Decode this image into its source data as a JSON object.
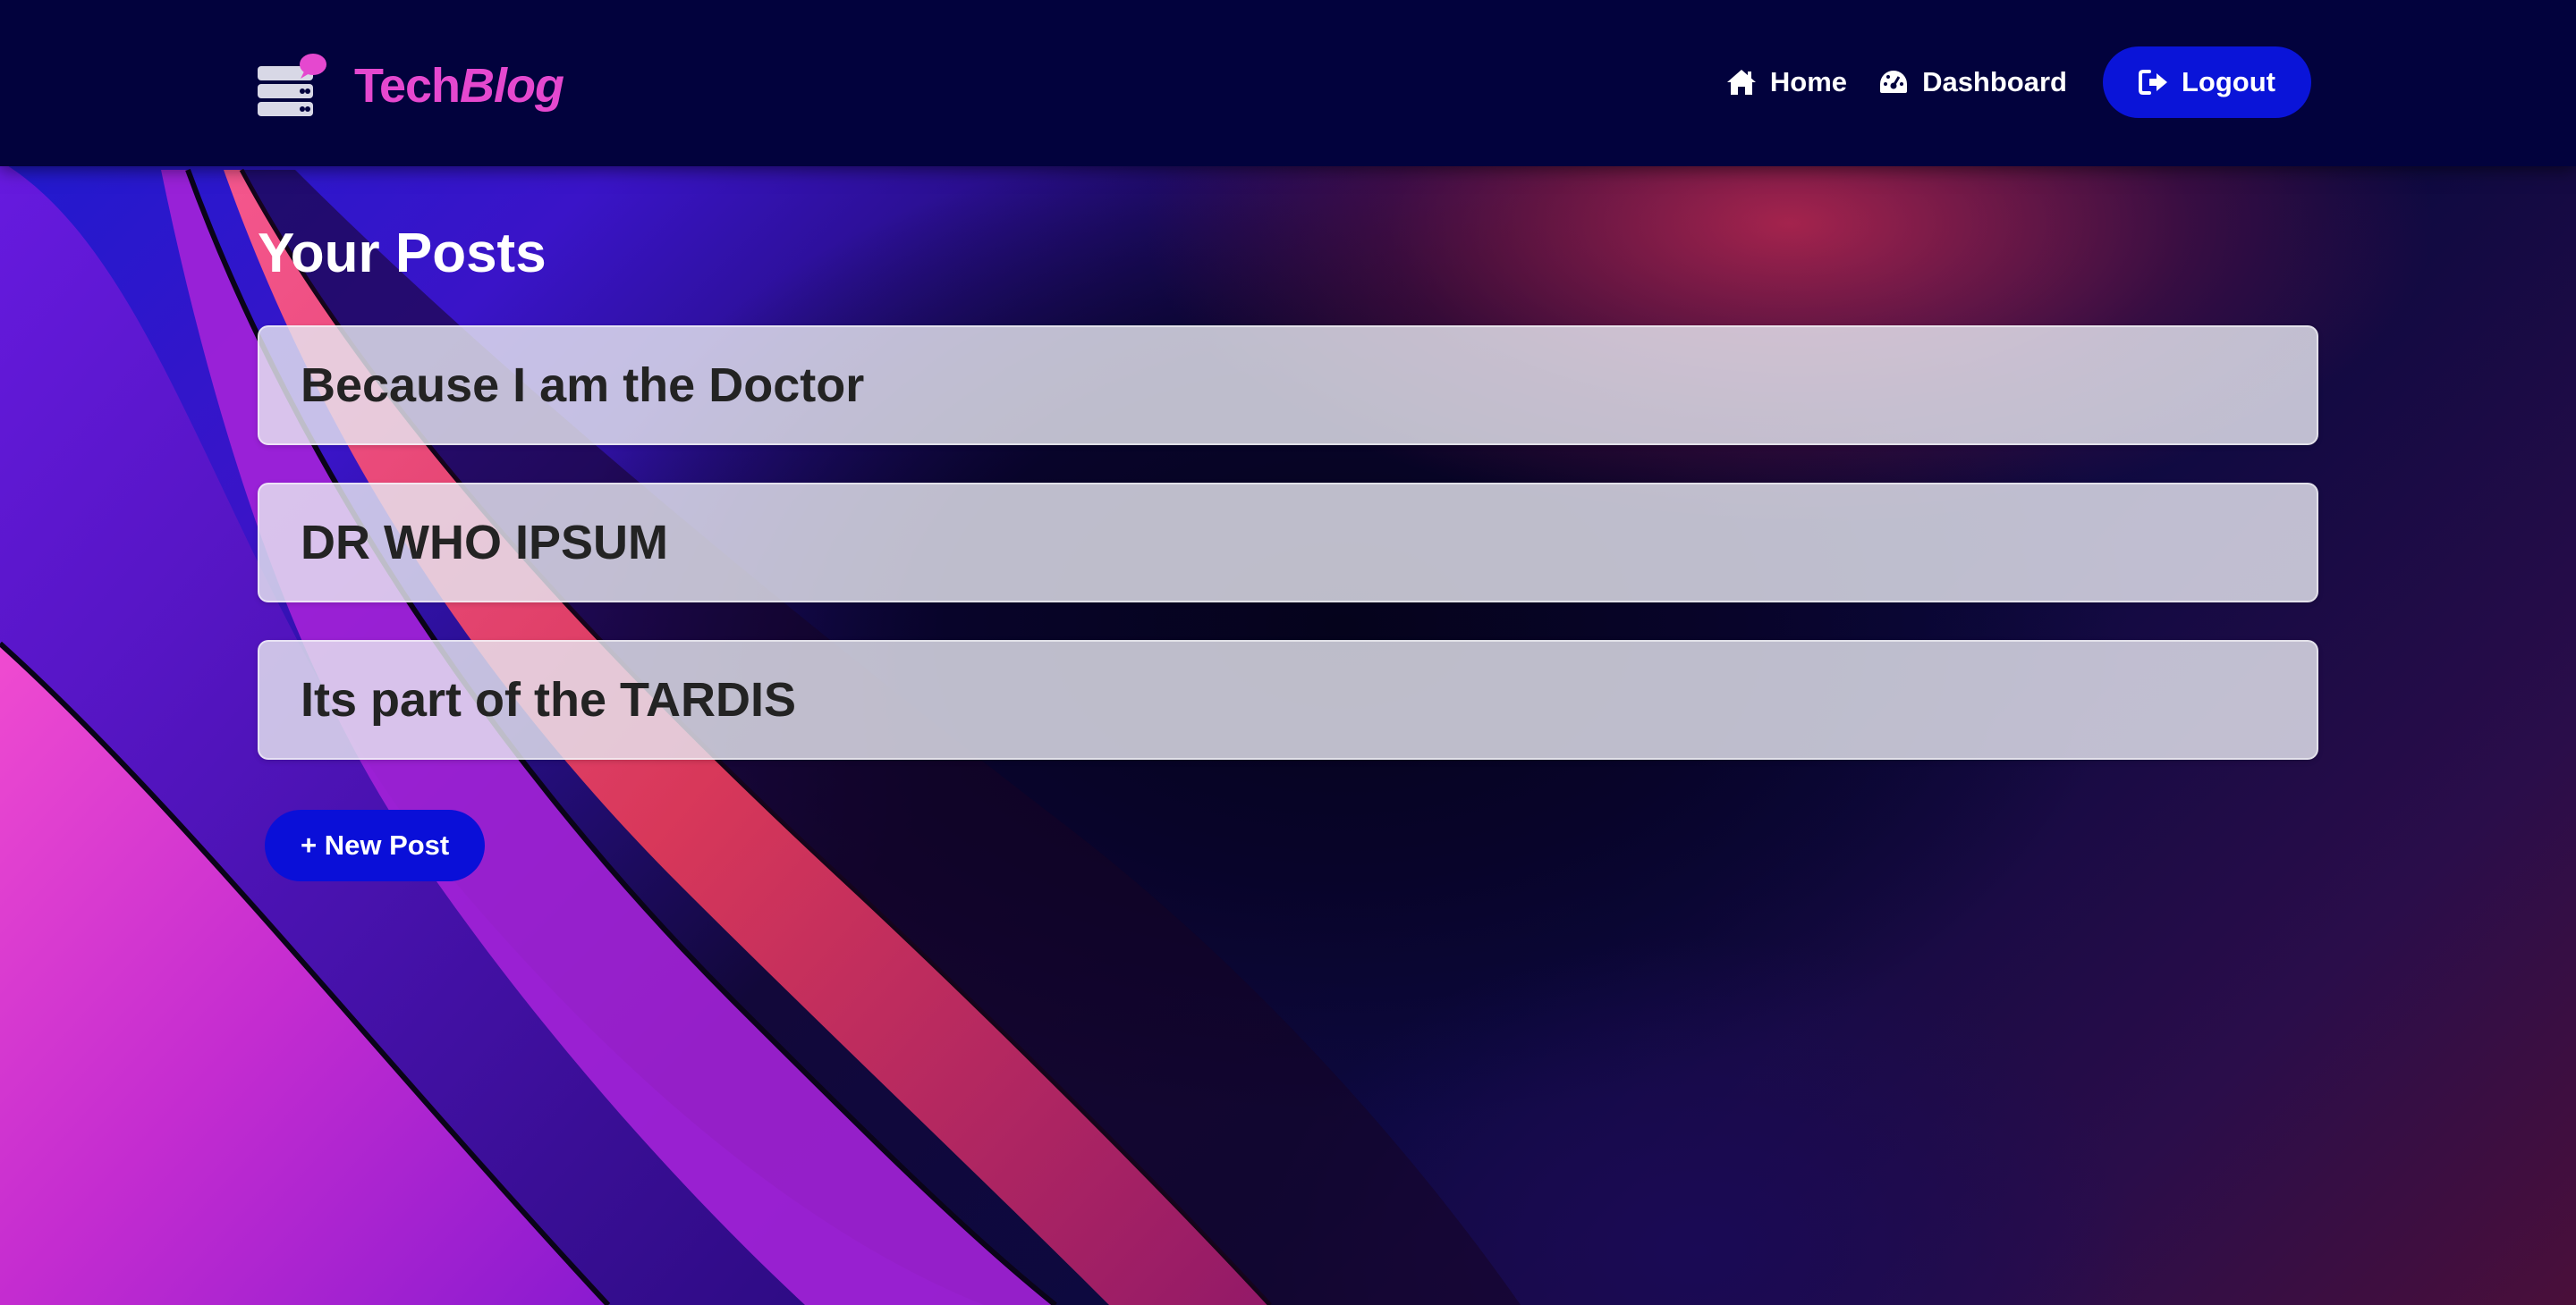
{
  "brand": {
    "name_plain": "Tech",
    "name_italic": "Blog",
    "color": "#e548cf",
    "icon": "server-chat-icon"
  },
  "nav": {
    "home": {
      "label": "Home",
      "icon": "home-icon"
    },
    "dashboard": {
      "label": "Dashboard",
      "icon": "dashboard-gauge-icon"
    },
    "logout": {
      "label": "Logout",
      "icon": "logout-icon"
    }
  },
  "main": {
    "title": "Your Posts",
    "posts": [
      {
        "title": "Because I am the Doctor"
      },
      {
        "title": "DR WHO IPSUM"
      },
      {
        "title": "Its part of the TARDIS"
      }
    ],
    "new_post_label": "+ New Post"
  },
  "colors": {
    "navbar_bg": "#02023d",
    "primary_button": "#0a14d8",
    "card_bg": "#e6e6f0"
  }
}
